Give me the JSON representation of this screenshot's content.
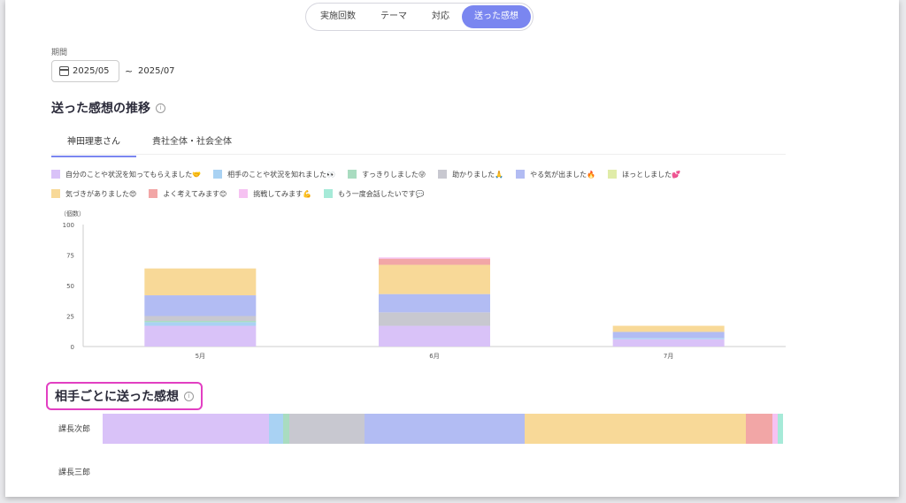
{
  "tabs": [
    {
      "label": "実施回数",
      "active": false
    },
    {
      "label": "テーマ",
      "active": false
    },
    {
      "label": "対応",
      "active": false
    },
    {
      "label": "送った感想",
      "active": true
    }
  ],
  "period": {
    "label": "期間",
    "start": "2025/05",
    "separator": "~",
    "end": "2025/07"
  },
  "trend": {
    "title": "送った感想の推移",
    "info": "i"
  },
  "subtabs": [
    {
      "label": "神田理恵さん",
      "active": true
    },
    {
      "label": "貴社全体・社会全体",
      "active": false
    }
  ],
  "legend": [
    {
      "label": "自分のことや状況を知ってもらえました🤝",
      "color": "#d9c2f8"
    },
    {
      "label": "相手のことや状況を知れました👀",
      "color": "#a9d2f3"
    },
    {
      "label": "すっきりしました😜",
      "color": "#a9dcc0"
    },
    {
      "label": "助かりました🙏",
      "color": "#c8c8d0"
    },
    {
      "label": "やる気が出ました🔥",
      "color": "#b2bcf3"
    },
    {
      "label": "ほっとしました💕",
      "color": "#e0eca8"
    },
    {
      "label": "気づきがありました😍",
      "color": "#f8d998"
    },
    {
      "label": "よく考えてみます😊",
      "color": "#f2a6a6"
    },
    {
      "label": "挑戦してみます💪",
      "color": "#f6c2f2"
    },
    {
      "label": "もう一度会話したいです💬",
      "color": "#a6ead8"
    }
  ],
  "chart_data": {
    "type": "bar",
    "stacked": true,
    "ylabel": "（個数）",
    "ylim": [
      0,
      100
    ],
    "yticks": [
      0,
      25,
      50,
      75,
      100
    ],
    "categories": [
      "5月",
      "6月",
      "7月"
    ],
    "series": [
      {
        "name": "自分のことや状況を知ってもらえました🤝",
        "color": "#d9c2f8",
        "values": [
          17,
          17,
          6
        ]
      },
      {
        "name": "相手のことや状況を知れました👀",
        "color": "#a9d2f3",
        "values": [
          3,
          0,
          1
        ]
      },
      {
        "name": "すっきりしました😜",
        "color": "#a9dcc0",
        "values": [
          1,
          0,
          0
        ]
      },
      {
        "name": "助かりました🙏",
        "color": "#c8c8d0",
        "values": [
          4,
          11,
          0
        ]
      },
      {
        "name": "やる気が出ました🔥",
        "color": "#b2bcf3",
        "values": [
          17,
          15,
          5
        ]
      },
      {
        "name": "ほっとしました💕",
        "color": "#e0eca8",
        "values": [
          0,
          0,
          0
        ]
      },
      {
        "name": "気づきがありました😍",
        "color": "#f8d998",
        "values": [
          22,
          24,
          5
        ]
      },
      {
        "name": "よく考えてみます😊",
        "color": "#f2a6a6",
        "values": [
          0,
          5,
          0
        ]
      },
      {
        "name": "挑戦してみます💪",
        "color": "#f6c2f2",
        "values": [
          0,
          1,
          0
        ]
      },
      {
        "name": "もう一度会話したいです💬",
        "color": "#a6ead8",
        "values": [
          0,
          0,
          0
        ]
      }
    ]
  },
  "per_partner": {
    "title": "相手ごとに送った感想",
    "info": "i",
    "rows": [
      {
        "name": "課長次郎",
        "shares": [
          {
            "color": "#d9c2f8",
            "value": 24.5
          },
          {
            "color": "#a9d2f3",
            "value": 2
          },
          {
            "color": "#a9dcc0",
            "value": 1
          },
          {
            "color": "#c8c8d0",
            "value": 11
          },
          {
            "color": "#b2bcf3",
            "value": 23.5
          },
          {
            "color": "#f8d998",
            "value": 32.5
          },
          {
            "color": "#f2a6a6",
            "value": 4
          },
          {
            "color": "#f6c2f2",
            "value": 0.7
          },
          {
            "color": "#a6ead8",
            "value": 0.8
          }
        ]
      },
      {
        "name": "課長三郎",
        "shares": []
      }
    ]
  }
}
